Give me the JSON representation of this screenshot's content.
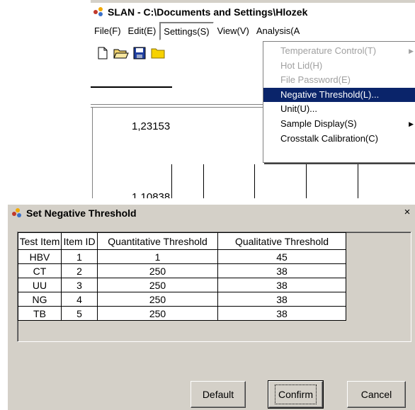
{
  "app": {
    "title": "SLAN - C:\\Documents and Settings\\Hlozek",
    "menu": [
      "File(F)",
      "Edit(E)",
      "Settings(S)",
      "View(V)",
      "Analysis(A"
    ],
    "toolbar_icons": [
      "new-file-icon",
      "open-folder-icon",
      "save-icon",
      "folder-icon"
    ],
    "axis_ticks": [
      "1,23153",
      "1,10838"
    ],
    "settings_menu": {
      "items": [
        {
          "label": "Temperature Control(T)",
          "disabled": true,
          "submenu": true
        },
        {
          "label": "Hot Lid(H)",
          "disabled": true
        },
        {
          "label": "File Password(E)",
          "disabled": true
        },
        {
          "label": "Negative Threshold(L)...",
          "highlighted": true
        },
        {
          "label": "Unit(U)..."
        },
        {
          "label": "Sample Display(S)",
          "submenu": true
        },
        {
          "label": "Crosstalk Calibration(C)"
        }
      ]
    }
  },
  "dialog": {
    "title": "Set Negative Threshold",
    "close_glyph": "×",
    "table": {
      "headers": [
        "Test Item",
        "Item ID",
        "Quantitative Threshold",
        "Qualitative Threshold"
      ],
      "rows": [
        [
          "HBV",
          "1",
          "1",
          "45"
        ],
        [
          "CT",
          "2",
          "250",
          "38"
        ],
        [
          "UU",
          "3",
          "250",
          "38"
        ],
        [
          "NG",
          "4",
          "250",
          "38"
        ],
        [
          "TB",
          "5",
          "250",
          "38"
        ]
      ]
    },
    "buttons": {
      "default": "Default",
      "confirm": "Confirm",
      "cancel": "Cancel"
    }
  },
  "colors": {
    "menu_highlight": "#0a246a",
    "dialog_face": "#d4d0c8",
    "disabled_text": "#a0a0a0"
  }
}
